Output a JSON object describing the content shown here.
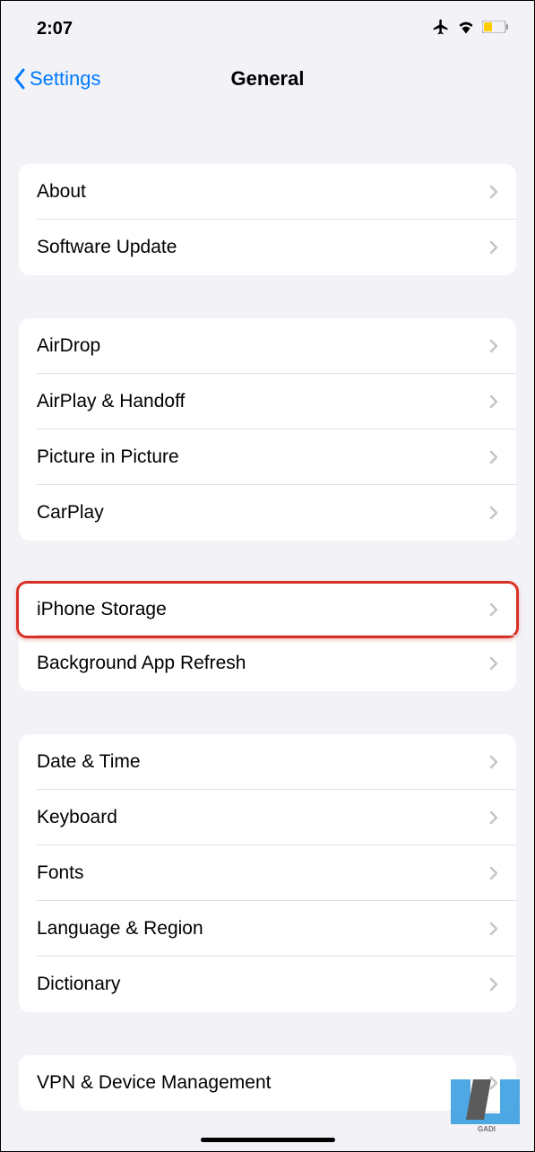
{
  "statusBar": {
    "time": "2:07"
  },
  "nav": {
    "back": "Settings",
    "title": "General"
  },
  "groups": [
    {
      "items": [
        {
          "label": "About"
        },
        {
          "label": "Software Update"
        }
      ]
    },
    {
      "items": [
        {
          "label": "AirDrop"
        },
        {
          "label": "AirPlay & Handoff"
        },
        {
          "label": "Picture in Picture"
        },
        {
          "label": "CarPlay"
        }
      ]
    },
    {
      "items": [
        {
          "label": "iPhone Storage",
          "highlighted": true
        },
        {
          "label": "Background App Refresh"
        }
      ]
    },
    {
      "items": [
        {
          "label": "Date & Time"
        },
        {
          "label": "Keyboard"
        },
        {
          "label": "Fonts"
        },
        {
          "label": "Language & Region"
        },
        {
          "label": "Dictionary"
        }
      ]
    },
    {
      "items": [
        {
          "label": "VPN & Device Management"
        }
      ]
    }
  ]
}
